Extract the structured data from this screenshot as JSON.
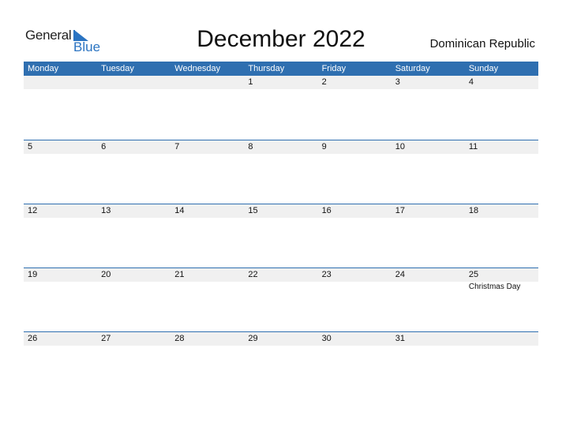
{
  "logo": {
    "general": "General",
    "blue": "Blue"
  },
  "title": "December 2022",
  "country": "Dominican Republic",
  "colors": {
    "accent": "#2f6fb0",
    "date_strip": "#f0f0f0"
  },
  "weekdays": [
    "Monday",
    "Tuesday",
    "Wednesday",
    "Thursday",
    "Friday",
    "Saturday",
    "Sunday"
  ],
  "weeks": [
    [
      "",
      "",
      "",
      "1",
      "2",
      "3",
      "4"
    ],
    [
      "5",
      "6",
      "7",
      "8",
      "9",
      "10",
      "11"
    ],
    [
      "12",
      "13",
      "14",
      "15",
      "16",
      "17",
      "18"
    ],
    [
      "19",
      "20",
      "21",
      "22",
      "23",
      "24",
      "25"
    ],
    [
      "26",
      "27",
      "28",
      "29",
      "30",
      "31",
      ""
    ]
  ],
  "events": [
    {
      "week": 3,
      "day": 6,
      "label": "Christmas Day"
    }
  ]
}
